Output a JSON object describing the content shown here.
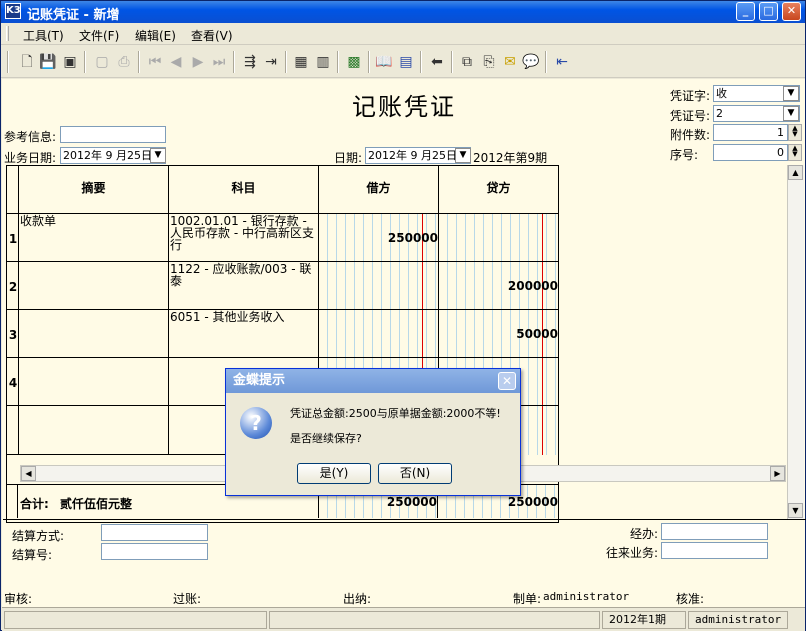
{
  "window": {
    "title": "记账凭证 - 新增",
    "logo": "K3"
  },
  "menu": [
    "工具(T)",
    "文件(F)",
    "编辑(E)",
    "查看(V)"
  ],
  "toolbar_icons": [
    "new-icon",
    "save-icon",
    "save-all-icon",
    "preview-icon",
    "print-icon",
    "first-icon",
    "prev-icon",
    "next-icon",
    "last-icon",
    "insert-row-icon",
    "delete-row-icon",
    "calculator-icon",
    "ledger-icon",
    "grid-icon",
    "book-icon",
    "card-icon",
    "back-icon",
    "copy-icon",
    "attach-icon",
    "mail-icon",
    "message-icon",
    "exit-icon"
  ],
  "voucher": {
    "title": "记账凭证",
    "ref_label": "参考信息:",
    "ref_value": "",
    "biz_date_label": "业务日期:",
    "biz_date": "2012年 9 月25日",
    "date_label": "日期:",
    "date": "2012年 9 月25日",
    "period_text": "2012年第9期",
    "voucher_word_label": "凭证字:",
    "voucher_word": "收",
    "voucher_no_label": "凭证号:",
    "voucher_no": "2",
    "attachments_label": "附件数:",
    "attachments": "1",
    "seq_label": "序号:",
    "seq": "0"
  },
  "grid": {
    "headers": [
      "摘要",
      "科目",
      "借方",
      "贷方"
    ],
    "rows": [
      {
        "no": "1",
        "summary": "收款单",
        "account": "1002.01.01 - 银行存款 - 人民币存款 - 中行高新区支行",
        "debit": "250000",
        "credit": ""
      },
      {
        "no": "2",
        "summary": "",
        "account": "1122 - 应收账款/003 - 联泰",
        "debit": "",
        "credit": "200000"
      },
      {
        "no": "3",
        "summary": "",
        "account": "6051 - 其他业务收入",
        "debit": "",
        "credit": "50000"
      },
      {
        "no": "4",
        "summary": "",
        "account": "",
        "debit": "",
        "credit": ""
      }
    ],
    "total_label": "合计:",
    "total_words": "贰仟伍佰元整",
    "total_debit": "250000",
    "total_credit": "250000"
  },
  "footer": {
    "settle_method_label": "结算方式:",
    "settle_no_label": "结算号:",
    "handler_label": "经办:",
    "partner_label": "往来业务:",
    "audit_label": "审核:",
    "post_label": "过账:",
    "cashier_label": "出纳:",
    "maker_label": "制单:",
    "maker": "administrator",
    "approve_label": "核准:"
  },
  "status": {
    "period": "2012年1期",
    "user": "administrator"
  },
  "dialog": {
    "title": "金蝶提示",
    "line1": "凭证总金额:2500与原单据金额:2000不等!",
    "line2": "是否继续保存?",
    "yes": "是(Y)",
    "no": "否(N)"
  }
}
